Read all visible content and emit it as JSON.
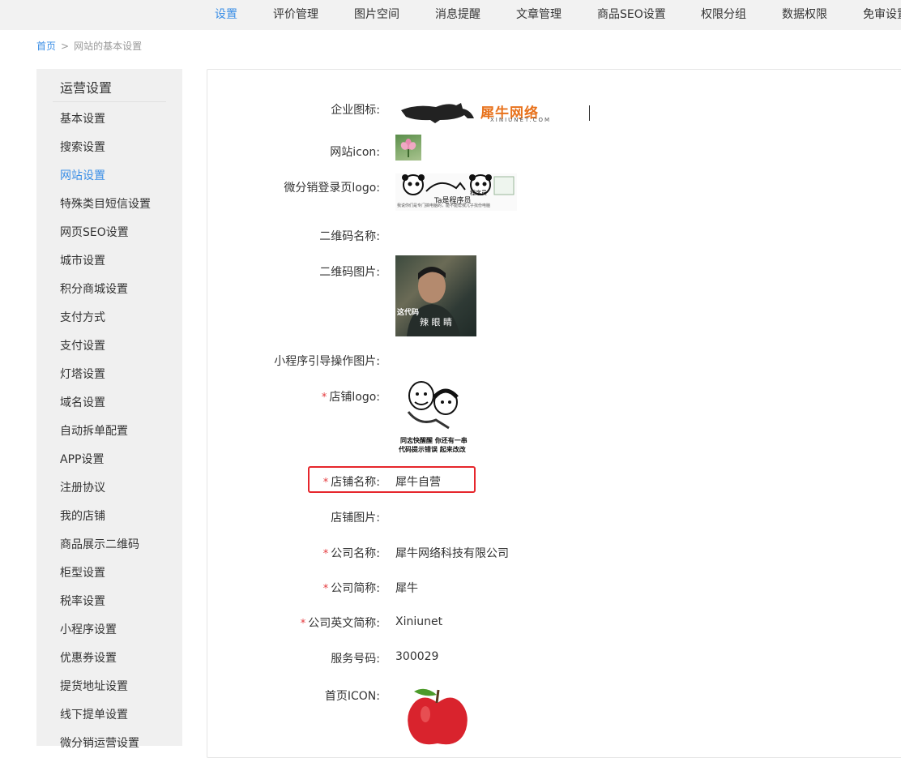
{
  "topnav": {
    "items": [
      "设置",
      "评价管理",
      "图片空间",
      "消息提醒",
      "文章管理",
      "商品SEO设置",
      "权限分组",
      "数据权限",
      "免审设置"
    ],
    "active": "设置"
  },
  "breadcrumb": {
    "home": "首页",
    "separator": ">",
    "current": "网站的基本设置"
  },
  "sidebar": {
    "title": "运营设置",
    "items": [
      "基本设置",
      "搜索设置",
      "网站设置",
      "特殊类目短信设置",
      "网页SEO设置",
      "城市设置",
      "积分商城设置",
      "支付方式",
      "支付设置",
      "灯塔设置",
      "域名设置",
      "自动拆单配置",
      "APP设置",
      "注册协议",
      "我的店铺",
      "商品展示二维码",
      "柜型设置",
      "税率设置",
      "小程序设置",
      "优惠券设置",
      "提货地址设置",
      "线下提单设置",
      "微分销运营设置"
    ],
    "active": "网站设置"
  },
  "form": {
    "company_logo_label": "企业图标:",
    "site_icon_label": "网站icon:",
    "dist_logo_label": "微分销登录页logo:",
    "qr_name_label": "二维码名称:",
    "qr_image_label": "二维码图片:",
    "miniapp_guide_label": "小程序引导操作图片:",
    "store_logo_label": "店铺logo:",
    "store_name_label": "店铺名称:",
    "store_name_value": "犀牛自营",
    "store_image_label": "店铺图片:",
    "company_name_label": "公司名称:",
    "company_name_value": "犀牛网络科技有限公司",
    "company_short_label": "公司简称:",
    "company_short_value": "犀牛",
    "company_en_label": "公司英文简称:",
    "company_en_value": "Xiniunet",
    "service_no_label": "服务号码:",
    "service_no_value": "300029",
    "home_icon_label": "首页ICON:",
    "required_mark": "*"
  },
  "images": {
    "company_logo_cn": "犀牛网络",
    "company_logo_en": "XINIUNET.COM",
    "dist_logo_text": "Ta是程序员",
    "dist_logo_tag": "程序员",
    "dist_logo_caption": "我说你们是专门搞电脑的，能不能帮我儿子找份电脑",
    "qr_caption1": "这代码",
    "qr_caption2": "辣 眼 睛",
    "store_logo_caption1": "同志快醒醒 你还有一串",
    "store_logo_caption2": "代码提示错误 起来改改"
  },
  "colors": {
    "accent": "#3a8ee6",
    "required": "#e4393c",
    "highlight": "#e6262c"
  }
}
